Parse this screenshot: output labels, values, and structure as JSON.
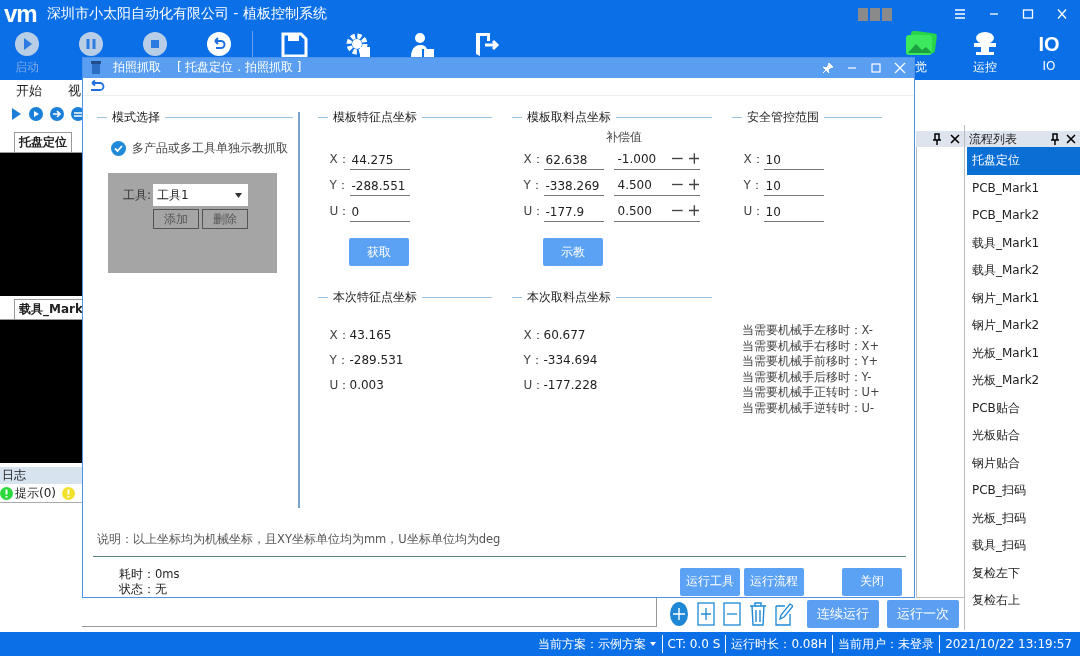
{
  "app": {
    "logo": "vm",
    "title": "深圳市小太阳自动化有限公司 - 植板控制系统"
  },
  "toolbar": {
    "start_label": "启动",
    "right": [
      {
        "label": "觉"
      },
      {
        "label": "运控"
      },
      {
        "label": "IO",
        "glyph": "IO"
      }
    ]
  },
  "menu": [
    "开始",
    "视"
  ],
  "view_tabs": [
    {
      "label": "托盘定位"
    },
    {
      "label": "载具_Mark"
    }
  ],
  "log": {
    "title": "日志",
    "items": [
      {
        "kind": "info",
        "label": "提示(0)"
      },
      {
        "kind": "warning"
      }
    ]
  },
  "flow_list": {
    "title": "流程列表",
    "items": [
      {
        "label": "托盘定位",
        "selected": true
      },
      {
        "label": "PCB_Mark1",
        "selected": false
      },
      {
        "label": "PCB_Mark2",
        "selected": false
      },
      {
        "label": "载具_Mark1",
        "selected": false
      },
      {
        "label": "载具_Mark2",
        "selected": false
      },
      {
        "label": "钢片_Mark1",
        "selected": false
      },
      {
        "label": "钢片_Mark2",
        "selected": false
      },
      {
        "label": "光板_Mark1",
        "selected": false
      },
      {
        "label": "光板_Mark2",
        "selected": false
      },
      {
        "label": "PCB贴合",
        "selected": false
      },
      {
        "label": "光板贴合",
        "selected": false
      },
      {
        "label": "钢片贴合",
        "selected": false
      },
      {
        "label": "PCB_扫码",
        "selected": false
      },
      {
        "label": "光板_扫码",
        "selected": false
      },
      {
        "label": "载具_扫码",
        "selected": false
      },
      {
        "label": "复检左下",
        "selected": false
      },
      {
        "label": "复检右上",
        "selected": false
      }
    ]
  },
  "run_buttons": [
    "连续运行",
    "运行一次"
  ],
  "status_bar": [
    "当前方案：示例方案",
    "CT: 0.0 S",
    "运行时长：0.08H",
    "当前用户：未登录",
    "2021/10/22 13:19:57"
  ],
  "dialog": {
    "title": "拍照抓取",
    "path": "[ 托盘定位 . 拍照抓取 ]",
    "mode": {
      "title": "模式选择",
      "option": {
        "label": "多产品或多工具单独示教抓取",
        "checked": true
      },
      "tool_label": "工具:",
      "tool_value": "工具1",
      "buttons": [
        "添加",
        "删除"
      ]
    },
    "template_feature": {
      "title": "模板特征点坐标",
      "fields": [
        {
          "axis": "X：",
          "value": "44.275"
        },
        {
          "axis": "Y：",
          "value": "-288.551"
        },
        {
          "axis": "U：",
          "value": "0"
        }
      ],
      "button": "获取"
    },
    "template_pick": {
      "title": "模板取料点坐标",
      "comp_header": "补偿值",
      "fields": [
        {
          "axis": "X：",
          "value": "62.638",
          "comp": "-1.000"
        },
        {
          "axis": "Y：",
          "value": "-338.269",
          "comp": "4.500"
        },
        {
          "axis": "U：",
          "value": "-177.9",
          "comp": "0.500"
        }
      ],
      "button": "示教"
    },
    "safety": {
      "title": "安全管控范围",
      "fields": [
        {
          "axis": "X：",
          "value": "10"
        },
        {
          "axis": "Y：",
          "value": "10"
        },
        {
          "axis": "U：",
          "value": "10"
        }
      ]
    },
    "current_feature": {
      "title": "本次特征点坐标",
      "rows": [
        {
          "axis": "X：",
          "value": "43.165"
        },
        {
          "axis": "Y：",
          "value": "-289.531"
        },
        {
          "axis": "U：",
          "value": "0.003"
        }
      ]
    },
    "current_pick": {
      "title": "本次取料点坐标",
      "rows": [
        {
          "axis": "X：",
          "value": "60.677"
        },
        {
          "axis": "Y：",
          "value": "-334.694"
        },
        {
          "axis": "U：",
          "value": "-177.228"
        }
      ]
    },
    "hints": [
      "当需要机械手左移时：X-",
      "当需要机械手右移时：X+",
      "当需要机械手前移时：Y+",
      "当需要机械手后移时：Y-",
      "当需要机械手正转时：U+",
      "当需要机械手逆转时：U-"
    ],
    "note": "说明：以上坐标均为机械坐标，且XY坐标单位均为mm，U坐标单位均为deg",
    "elapsed": "耗时：0ms",
    "status": "状态：无",
    "buttons": [
      "运行工具",
      "运行流程"
    ],
    "close": "关闭"
  }
}
